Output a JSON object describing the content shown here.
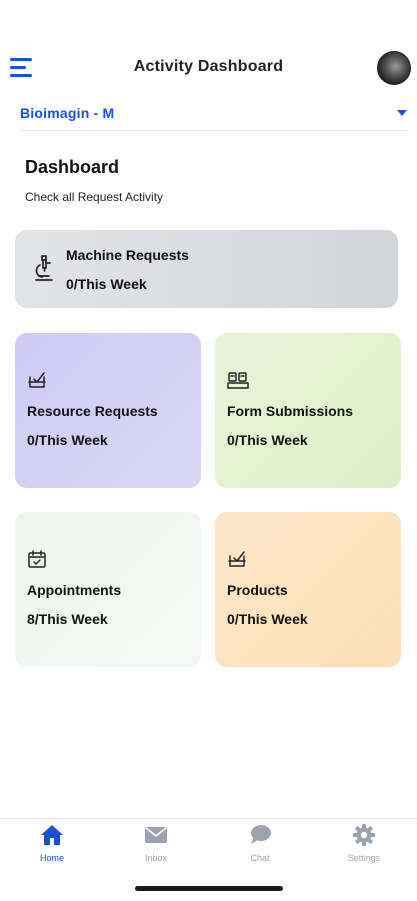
{
  "header": {
    "title": "Activity Dashboard",
    "menu_icon": "hamburger-menu-icon",
    "avatar_icon": "user-avatar"
  },
  "organization": {
    "selected": "Bioimagin - M"
  },
  "dashboard": {
    "title": "Dashboard",
    "subtitle": "Check all Request Activity"
  },
  "cards": {
    "machine": {
      "label": "Machine Requests",
      "count": "0/This Week",
      "icon": "microscope-icon",
      "color": "#d9dbe0"
    },
    "resource": {
      "label": "Resource Requests",
      "count": "0/This Week",
      "icon": "checkbox-tray-icon",
      "color": "#d4d0f5"
    },
    "form": {
      "label": "Form Submissions",
      "count": "0/This Week",
      "icon": "form-cards-icon",
      "color": "#e2f1d1"
    },
    "appointments": {
      "label": "Appointments",
      "count": "8/This Week",
      "icon": "calendar-check-icon",
      "color": "#f0f7f0"
    },
    "products": {
      "label": "Products",
      "count": "0/This Week",
      "icon": "product-tray-icon",
      "color": "#fce3c0"
    }
  },
  "tabs": [
    {
      "label": "Home",
      "icon": "home-icon",
      "active": true
    },
    {
      "label": "Inbox",
      "icon": "envelope-icon",
      "active": false
    },
    {
      "label": "Chat",
      "icon": "chat-bubble-icon",
      "active": false
    },
    {
      "label": "Settings",
      "icon": "gear-icon",
      "active": false
    }
  ],
  "colors": {
    "accent": "#1d4ed8",
    "inactive": "#9ca3af"
  }
}
